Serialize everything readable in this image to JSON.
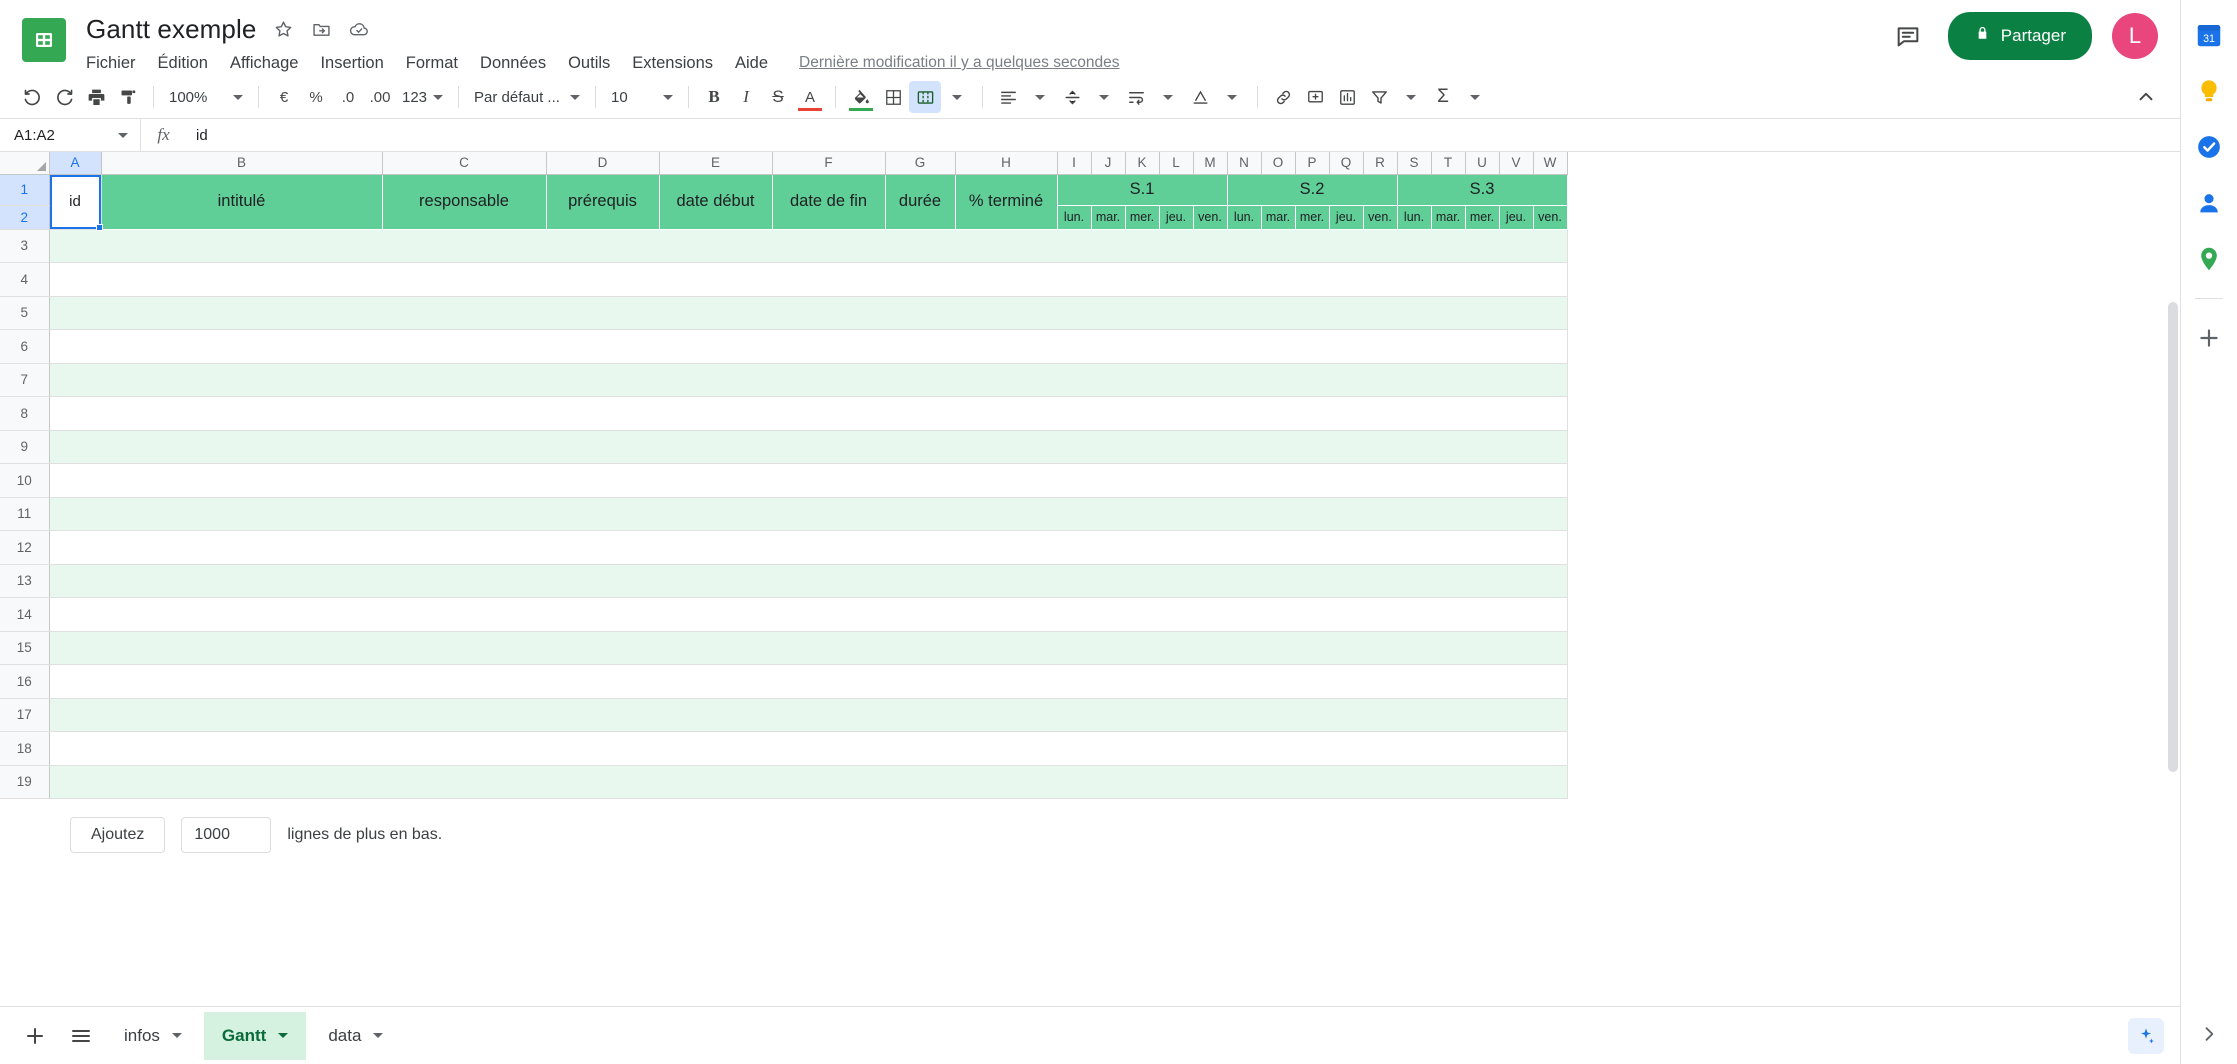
{
  "app": {
    "doc_title": "Gantt exemple",
    "last_modified": "Dernière modification il y a quelques secondes",
    "share_label": "Partager",
    "avatar_initial": "L"
  },
  "title_icons": [
    {
      "name": "star-icon",
      "title": "Ajouter aux favoris"
    },
    {
      "name": "move-to-folder-icon",
      "title": "Déplacer"
    },
    {
      "name": "cloud-saved-icon",
      "title": "Enregistré dans Drive"
    }
  ],
  "menus": [
    {
      "label": "Fichier"
    },
    {
      "label": "Édition"
    },
    {
      "label": "Affichage"
    },
    {
      "label": "Insertion"
    },
    {
      "label": "Format"
    },
    {
      "label": "Données"
    },
    {
      "label": "Outils"
    },
    {
      "label": "Extensions"
    },
    {
      "label": "Aide"
    }
  ],
  "toolbar": {
    "undo": "undo-icon",
    "redo": "redo-icon",
    "print": "print-icon",
    "paint": "paint-format-icon",
    "zoom_value": "100%",
    "currency": "€",
    "percent": "%",
    "decrease_decimal": ".0",
    "increase_decimal": ".00",
    "number_format": "123",
    "font_value": "Par défaut ...",
    "font_size_value": "10",
    "bold": "B",
    "italic": "I",
    "strikethrough": "S",
    "text_color": "A",
    "fill_color": "fill-color-icon",
    "borders": "borders-icon",
    "merge_cells": "merge-cells-icon",
    "horizontal_align": "horizontal-align-icon",
    "vertical_align": "vertical-align-icon",
    "text_wrap": "text-wrap-icon",
    "text_rotation": "text-rotation-icon",
    "insert_link": "insert-link-icon",
    "insert_comment": "insert-comment-icon",
    "insert_chart": "insert-chart-icon",
    "filter": "filter-icon",
    "functions": "functions-icon",
    "collapse": "collapse-toolbar-icon"
  },
  "formula_bar": {
    "name_box": "A1:A2",
    "fx": "fx",
    "formula_value": "id"
  },
  "grid": {
    "column_letters": [
      "A",
      "B",
      "C",
      "D",
      "E",
      "F",
      "G",
      "H",
      "I",
      "J",
      "K",
      "L",
      "M",
      "N",
      "O",
      "P",
      "Q",
      "R",
      "S",
      "T",
      "U",
      "V",
      "W"
    ],
    "row_numbers": [
      "1",
      "2",
      "3",
      "4",
      "5",
      "6",
      "7",
      "8",
      "9",
      "10",
      "11",
      "12",
      "13",
      "14",
      "15",
      "16",
      "17",
      "18",
      "19"
    ],
    "selection": "A1:A2",
    "header_row1": [
      {
        "col": "A",
        "text": "id"
      },
      {
        "col": "B",
        "text": "intitulé"
      },
      {
        "col": "C",
        "text": "responsable"
      },
      {
        "col": "D",
        "text": "prérequis"
      },
      {
        "col": "E",
        "text": "date début"
      },
      {
        "col": "F",
        "text": "date de fin"
      },
      {
        "col": "G",
        "text": "durée"
      },
      {
        "col": "H",
        "text": "% terminé"
      }
    ],
    "weeks": [
      "S.1",
      "S.2",
      "S.3"
    ],
    "days": [
      "lun.",
      "mar.",
      "mer.",
      "jeu.",
      "ven.",
      "lun.",
      "mar.",
      "mer.",
      "jeu.",
      "ven.",
      "lun.",
      "mar.",
      "mer.",
      "jeu.",
      "ven."
    ]
  },
  "add_rows": {
    "button_label": "Ajoutez",
    "count_value": "1000",
    "suffix_label": "lignes de plus en bas."
  },
  "sheet_tabs": {
    "add_sheet": "add-sheet-icon",
    "all_sheets": "all-sheets-icon",
    "tabs": [
      {
        "label": "infos",
        "active": false
      },
      {
        "label": "Gantt",
        "active": true
      },
      {
        "label": "data",
        "active": false
      }
    ],
    "explore": "explore-icon"
  },
  "side_panel": [
    {
      "name": "google-calendar-icon",
      "badge": "31"
    },
    {
      "name": "google-keep-icon"
    },
    {
      "name": "google-tasks-icon"
    },
    {
      "name": "google-contacts-icon"
    },
    {
      "name": "google-maps-icon"
    },
    {
      "name": "add-addon-icon"
    }
  ],
  "colors": {
    "brand_green": "#35a853",
    "share_green": "#0b8043",
    "header_green": "#5fcf97",
    "band_green": "#e8f8ee",
    "tab_active_bg": "#d5f2e0",
    "selection_blue": "#1a73e8",
    "avatar": "#e8467c"
  }
}
